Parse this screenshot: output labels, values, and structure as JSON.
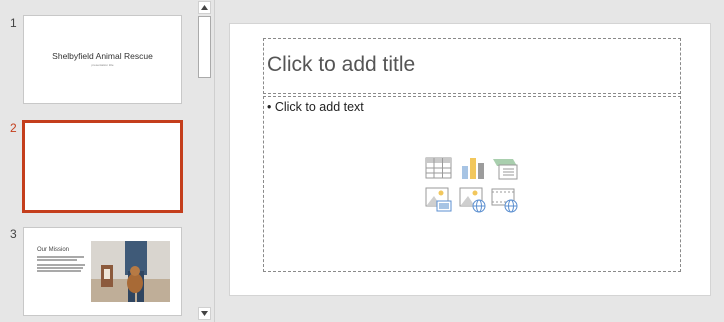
{
  "thumbnails": {
    "slides": [
      {
        "number": "1",
        "title": "Shelbyfield Animal Rescue",
        "subtitle": "presentation title"
      },
      {
        "number": "2"
      },
      {
        "number": "3",
        "title": "Our Mission"
      }
    ]
  },
  "slide": {
    "title_placeholder": "Click to add title",
    "body_placeholder": "• Click to add text",
    "content_icons": [
      "insert-table-icon",
      "insert-chart-icon",
      "insert-smartart-icon",
      "insert-picture-icon",
      "insert-online-picture-icon",
      "insert-video-icon"
    ]
  },
  "colors": {
    "selection": "#c43e1c",
    "pane_bg": "#e6e6e6",
    "slide_bg": "#ffffff"
  }
}
